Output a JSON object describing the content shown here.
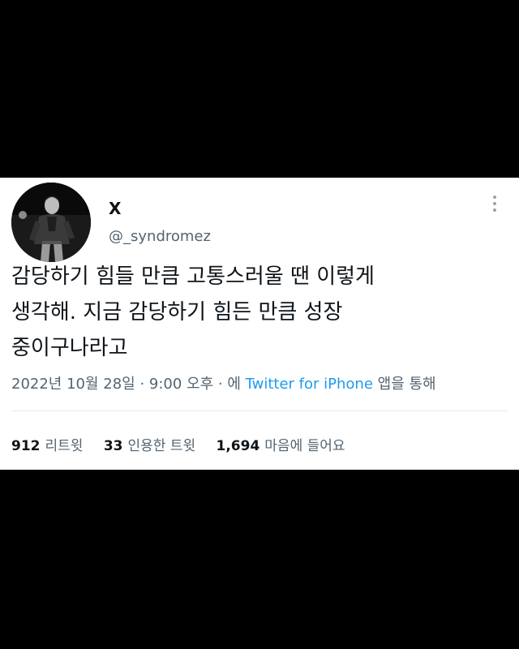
{
  "user": {
    "display_name": "X",
    "handle": "@_syndromez"
  },
  "tweet": {
    "text": "감당하기 힘들 만큼 고통스러울 땐 이렇게\n생각해. 지금 감당하기 힘든 만큼 성장\n중이구나라고",
    "date": "2022년 10월 28일 · 9:00 오후 · 에 ",
    "source": "Twitter for iPhone",
    "source_suffix": " 앱을 통해"
  },
  "stats": {
    "retweets": {
      "count": "912",
      "label": "리트윗"
    },
    "quotes": {
      "count": "33",
      "label": "인용한 트윗"
    },
    "likes": {
      "count": "1,694",
      "label": "마음에 들어요"
    }
  },
  "colors": {
    "text": "#0f1419",
    "secondary": "#536471",
    "link": "#1d9bf0",
    "background": "#000000"
  }
}
